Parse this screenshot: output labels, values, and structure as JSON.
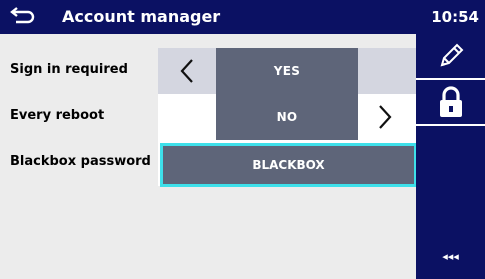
{
  "header": {
    "title": "Account manager",
    "time": "10:54",
    "back_icon": "back-arrow-icon"
  },
  "settings": [
    {
      "label": "Sign in required",
      "value": "YES",
      "left_arrow": "chevron-left-icon"
    },
    {
      "label": "Every reboot",
      "value": "NO",
      "right_arrow": "chevron-right-icon"
    }
  ],
  "password": {
    "label": "Blackbox password",
    "value": "BLACKBOX"
  },
  "sidebar": {
    "edit_icon": "pencil-icon",
    "lock_icon": "padlock-icon",
    "more_label": "◂◂◂"
  },
  "colors": {
    "title_bar": "#0b1163",
    "value_box": "#5e6579",
    "focus_border": "#3ee0ea",
    "content_bg": "#ececec"
  }
}
